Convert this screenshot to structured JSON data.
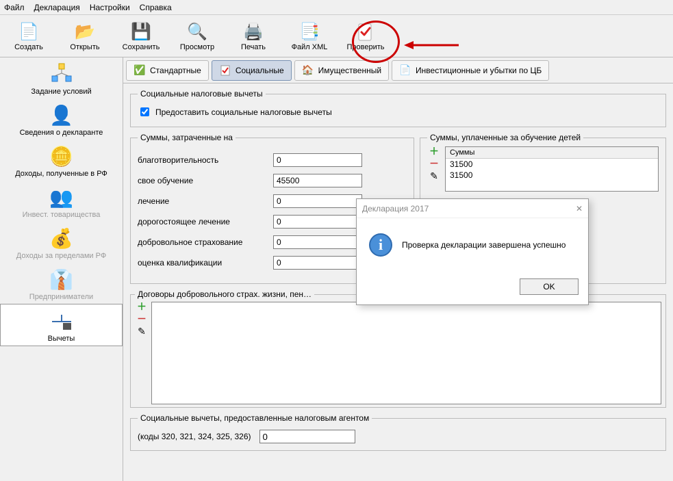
{
  "menu": {
    "file": "Файл",
    "declaration": "Декларация",
    "settings": "Настройки",
    "help": "Справка"
  },
  "toolbar": {
    "create": "Создать",
    "open": "Открыть",
    "save": "Сохранить",
    "preview": "Просмотр",
    "print": "Печать",
    "filexml": "Файл XML",
    "check": "Проверить"
  },
  "sidebar": {
    "conditions": "Задание условий",
    "declarant": "Сведения о декларанте",
    "income_rf": "Доходы, полученные в РФ",
    "invest_partn": "Инвест. товарищества",
    "income_abroad": "Доходы за пределами РФ",
    "entrepreneurs": "Предприниматели",
    "deductions": "Вычеты"
  },
  "tabs": {
    "standard": "Стандартные",
    "social": "Социальные",
    "property": "Имущественный",
    "invest": "Инвестиционные и убытки по ЦБ"
  },
  "social": {
    "group": "Социальные налоговые вычеты",
    "provide_label": "Предоставить социальные налоговые вычеты",
    "provide_checked": true,
    "spent_group": "Суммы, затраченные на",
    "charity_label": "благотворительность",
    "charity_value": "0",
    "edu_self_label": "свое обучение",
    "edu_self_value": "45500",
    "med_label": "лечение",
    "med_value": "0",
    "exp_med_label": "дорогостоящее лечение",
    "exp_med_value": "0",
    "insurance_label": "добровольное страхование",
    "insurance_value": "0",
    "qual_label": "оценка квалификации",
    "qual_value": "0",
    "children_edu_group": "Суммы, уплаченные за обучение детей",
    "sums_header": "Суммы",
    "children_rows": [
      "31500",
      "31500"
    ],
    "contracts_group": "Договоры добровольного страх. жизни, пен…",
    "agent_group": "Социальные вычеты, предоставленные налоговым агентом",
    "agent_codes_label": "(коды 320, 321, 324, 325, 326)",
    "agent_value": "0"
  },
  "dialog": {
    "title": "Декларация 2017",
    "message": "Проверка декларации завершена успешно",
    "ok": "OK",
    "close": "✕"
  }
}
